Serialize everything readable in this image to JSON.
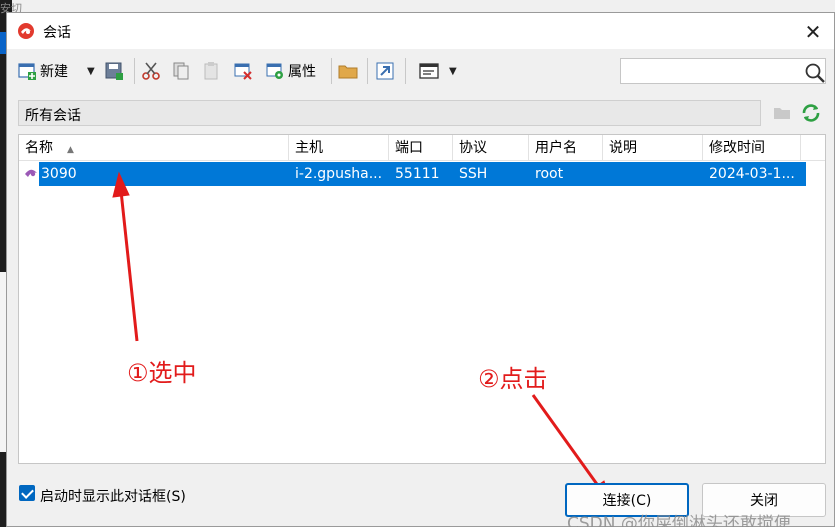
{
  "background": {
    "top_fragment": "安切"
  },
  "window": {
    "title": "会话",
    "close_glyph": "✕"
  },
  "toolbar": {
    "new_label": "新建",
    "properties_label": "属性"
  },
  "search": {
    "value": "",
    "placeholder": ""
  },
  "path": {
    "label": "所有会话"
  },
  "table": {
    "columns": [
      "名称",
      "主机",
      "端口",
      "协议",
      "用户名",
      "说明",
      "修改时间"
    ],
    "rows": [
      {
        "name": "3090",
        "host": "i-2.gpusha...",
        "port": "55111",
        "protocol": "SSH",
        "user": "root",
        "note": "",
        "modified": "2024-03-1..."
      }
    ]
  },
  "annotations": {
    "step1": "①选中",
    "step2": "②点击"
  },
  "footer": {
    "show_on_startup_label": "启动时显示此对话框(S)",
    "show_on_startup_checked": true,
    "connect_label": "连接(C)",
    "close_label": "关闭"
  },
  "watermark": "CSDN @你屎倒淋头还敢搅便",
  "colors": {
    "selection": "#0078d7",
    "annotation": "#e21b1b",
    "accent": "#0067c0"
  }
}
